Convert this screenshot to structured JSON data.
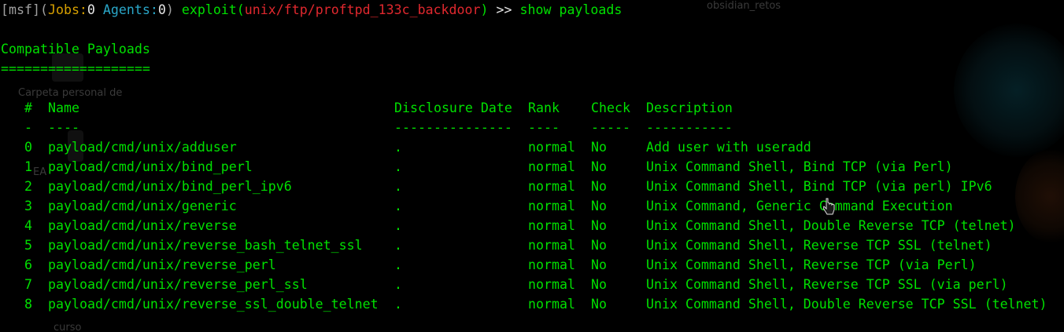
{
  "prompt": {
    "open_bracket": "[",
    "module_tag": "msf",
    "close_bracket_paren": "](",
    "jobs_label": "Jobs:",
    "jobs_value": "0",
    "agents_label": "Agents:",
    "agents_value": "0",
    "close_paren": ")",
    "exploit_prefix": "exploit(",
    "exploit_path": "unix/ftp/proftpd_133c_backdoor",
    "exploit_suffix": ")",
    "arrows": ">>",
    "command": "show payloads"
  },
  "section": {
    "title": "Compatible Payloads",
    "underline": "==================="
  },
  "table": {
    "headers": {
      "num": "#",
      "name": "Name",
      "disclosure_date": "Disclosure Date",
      "rank": "Rank",
      "check": "Check",
      "description": "Description"
    },
    "separators": {
      "num": "-",
      "name": "----",
      "disclosure_date": "---------------",
      "rank": "----",
      "check": "-----",
      "description": "-----------"
    },
    "rows": [
      {
        "num": "0",
        "name": "payload/cmd/unix/adduser",
        "date": ".",
        "rank": "normal",
        "check": "No",
        "description": "Add user with useradd"
      },
      {
        "num": "1",
        "name": "payload/cmd/unix/bind_perl",
        "date": ".",
        "rank": "normal",
        "check": "No",
        "description": "Unix Command Shell, Bind TCP (via Perl)"
      },
      {
        "num": "2",
        "name": "payload/cmd/unix/bind_perl_ipv6",
        "date": ".",
        "rank": "normal",
        "check": "No",
        "description": "Unix Command Shell, Bind TCP (via perl) IPv6"
      },
      {
        "num": "3",
        "name": "payload/cmd/unix/generic",
        "date": ".",
        "rank": "normal",
        "check": "No",
        "description": "Unix Command, Generic Command Execution"
      },
      {
        "num": "4",
        "name": "payload/cmd/unix/reverse",
        "date": ".",
        "rank": "normal",
        "check": "No",
        "description": "Unix Command Shell, Double Reverse TCP (telnet)"
      },
      {
        "num": "5",
        "name": "payload/cmd/unix/reverse_bash_telnet_ssl",
        "date": ".",
        "rank": "normal",
        "check": "No",
        "description": "Unix Command Shell, Reverse TCP SSL (telnet)"
      },
      {
        "num": "6",
        "name": "payload/cmd/unix/reverse_perl",
        "date": ".",
        "rank": "normal",
        "check": "No",
        "description": "Unix Command Shell, Reverse TCP (via Perl)"
      },
      {
        "num": "7",
        "name": "payload/cmd/unix/reverse_perl_ssl",
        "date": ".",
        "rank": "normal",
        "check": "No",
        "description": "Unix Command Shell, Reverse TCP SSL (via perl)"
      },
      {
        "num": "8",
        "name": "payload/cmd/unix/reverse_ssl_double_telnet",
        "date": ".",
        "rank": "normal",
        "check": "No",
        "description": "Unix Command Shell, Double Reverse TCP SSL (telnet)"
      }
    ]
  },
  "background": {
    "desktop_label_1": "obsidian_retos",
    "desktop_label_2": "Carpeta personal de",
    "desktop_label_3": "curso",
    "desktop_label_4": "EA"
  },
  "colors": {
    "terminal_bg": "#000000",
    "text_green": "#00e000",
    "prompt_gray": "#a0a0a0",
    "jobs_orange": "#d7a000",
    "agents_cyan": "#2aa7c9",
    "exploit_red": "#e0282e"
  },
  "icons": {
    "mouse_pointer": "pointer-cursor-icon"
  }
}
